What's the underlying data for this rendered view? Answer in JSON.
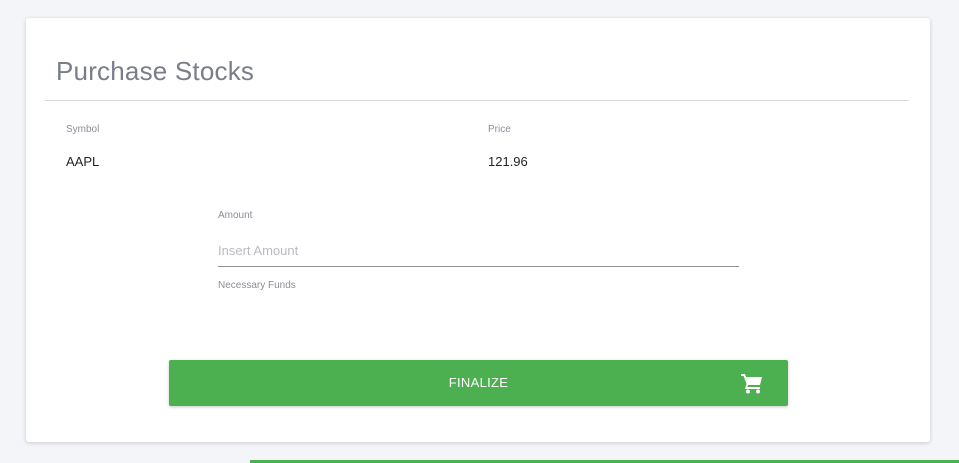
{
  "card": {
    "title": "Purchase Stocks"
  },
  "symbol": {
    "label": "Symbol",
    "value": "AAPL"
  },
  "price": {
    "label": "Price",
    "value": "121.96"
  },
  "amount": {
    "label": "Amount",
    "placeholder": "Insert Amount",
    "value": ""
  },
  "necessary_funds": {
    "label": "Necessary Funds"
  },
  "finalize_button": {
    "label": "Finalize",
    "icon": "shopping-cart-icon"
  },
  "colors": {
    "accent": "#4caf50",
    "title": "#7a7d8a",
    "label": "#8b8e98",
    "background": "#f4f5f8"
  }
}
